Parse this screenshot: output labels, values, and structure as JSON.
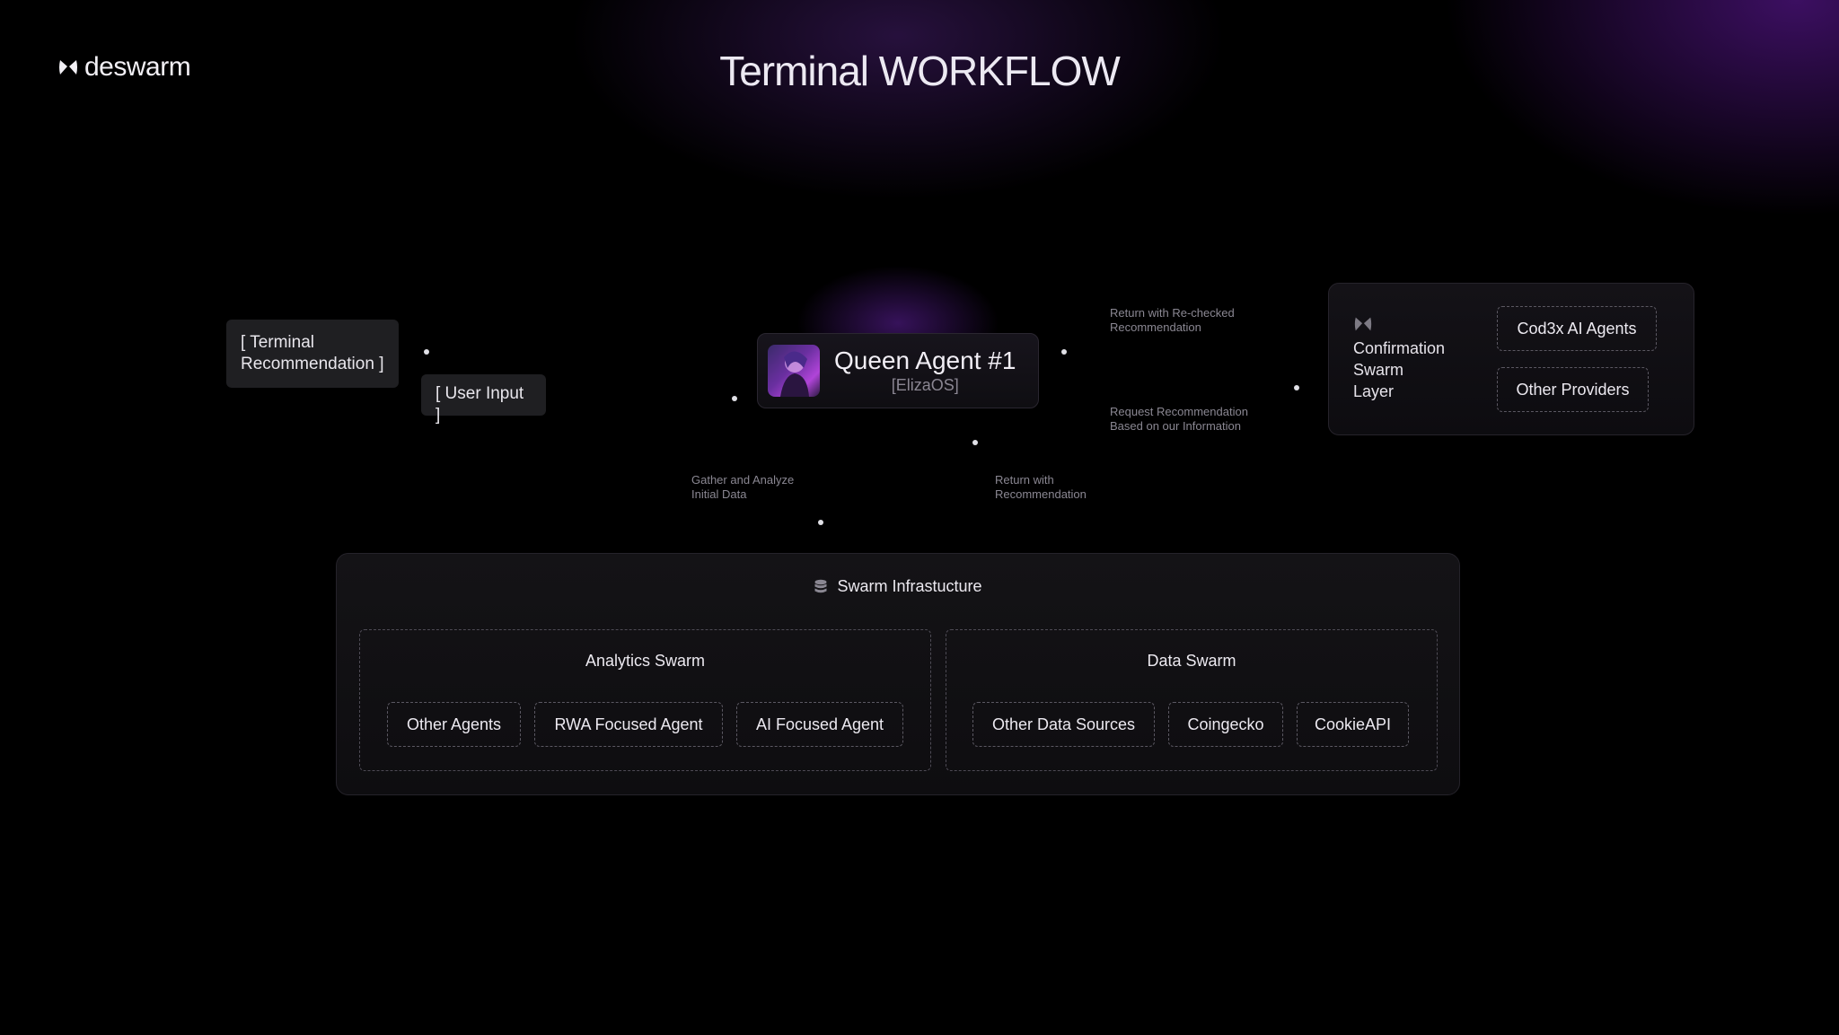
{
  "brand": {
    "name": "deswarm",
    "logo_icon": "butterfly-x-icon"
  },
  "title": "Terminal WORKFLOW",
  "inputs": {
    "terminal_recommendation_line1": "[ Terminal",
    "terminal_recommendation_line2": "Recommendation ]",
    "user_input": "[ User Input ]"
  },
  "queen": {
    "name": "Queen Agent #1",
    "subtitle": "[ElizaOS]"
  },
  "flows": {
    "return_rechecked_line1": "Return with Re-checked",
    "return_rechecked_line2": "Recommendation",
    "request_line1": "Request Recommendation",
    "request_line2": "Based on our Information",
    "gather_line1": "Gather and Analyze",
    "gather_line2": "Initial Data",
    "return_rec_line1": "Return with",
    "return_rec_line2": "Recommendation"
  },
  "confirmation": {
    "label_line1": "Confirmation",
    "label_line2": "Swarm",
    "label_line3": "Layer",
    "items": [
      "Cod3x AI Agents",
      "Other Providers"
    ]
  },
  "infrastructure": {
    "title": "Swarm Infrastucture",
    "icon": "database-icon",
    "analytics": {
      "title": "Analytics Swarm",
      "agents": [
        "Other Agents",
        "RWA Focused Agent",
        "AI Focused Agent"
      ]
    },
    "data": {
      "title": "Data Swarm",
      "sources": [
        "Other Data Sources",
        "Coingecko",
        "CookieAPI"
      ]
    }
  }
}
